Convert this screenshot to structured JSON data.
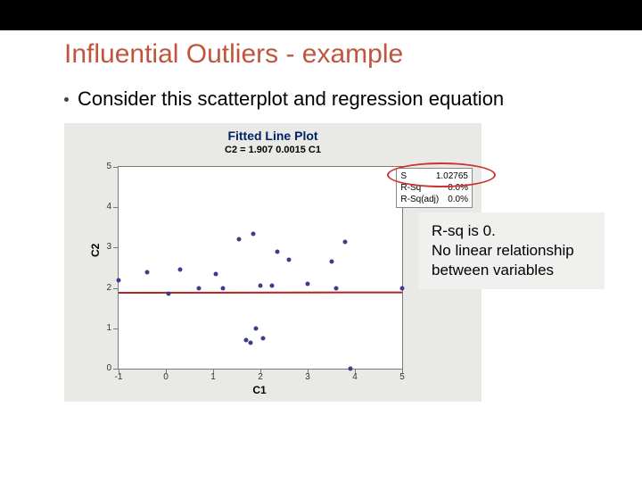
{
  "slide": {
    "title": "Influential Outliers - example",
    "bullet": "Consider this scatterplot and regression equation"
  },
  "plot": {
    "title_main": "Fitted Line Plot",
    "title_sub": "C2 = 1.907   0.0015 C1",
    "xlabel": "C1",
    "ylabel": "C2"
  },
  "stats": {
    "s_label": "S",
    "s_val": "1.02765",
    "rsq_label": "R-Sq",
    "rsq_val": "0.0%",
    "rsqa_label": "R-Sq(adj)",
    "rsqa_val": "0.0%"
  },
  "callout": {
    "line1": "R-sq is 0.",
    "line2": "No linear relationship",
    "line3": "between variables"
  },
  "chart_data": {
    "type": "scatter",
    "title": "Fitted Line Plot",
    "subtitle": "C2 = 1.907   0.0015 C1",
    "xlabel": "C1",
    "ylabel": "C2",
    "xlim": [
      -1,
      5
    ],
    "ylim": [
      0,
      5
    ],
    "xticks": [
      -1,
      0,
      1,
      2,
      3,
      4,
      5
    ],
    "yticks": [
      0,
      1,
      2,
      3,
      4,
      5
    ],
    "regression_line": {
      "intercept": 1.907,
      "slope": 0.0015
    },
    "series": [
      {
        "name": "data",
        "points": [
          {
            "x": -1.0,
            "y": 2.2
          },
          {
            "x": -0.4,
            "y": 2.4
          },
          {
            "x": 0.05,
            "y": 1.85
          },
          {
            "x": 0.3,
            "y": 2.45
          },
          {
            "x": 0.7,
            "y": 2.0
          },
          {
            "x": 1.05,
            "y": 2.35
          },
          {
            "x": 1.2,
            "y": 2.0
          },
          {
            "x": 1.55,
            "y": 3.2
          },
          {
            "x": 1.85,
            "y": 3.35
          },
          {
            "x": 1.7,
            "y": 0.7
          },
          {
            "x": 1.8,
            "y": 0.65
          },
          {
            "x": 1.9,
            "y": 1.0
          },
          {
            "x": 2.0,
            "y": 2.05
          },
          {
            "x": 2.05,
            "y": 0.75
          },
          {
            "x": 2.25,
            "y": 2.05
          },
          {
            "x": 2.35,
            "y": 2.9
          },
          {
            "x": 2.6,
            "y": 2.7
          },
          {
            "x": 3.0,
            "y": 2.1
          },
          {
            "x": 3.5,
            "y": 2.65
          },
          {
            "x": 3.6,
            "y": 2.0
          },
          {
            "x": 3.8,
            "y": 3.15
          },
          {
            "x": 3.9,
            "y": 0.0
          },
          {
            "x": 5.0,
            "y": 2.0
          }
        ]
      }
    ],
    "stats": {
      "S": 1.02765,
      "R-Sq": "0.0%",
      "R-Sq(adj)": "0.0%"
    }
  }
}
